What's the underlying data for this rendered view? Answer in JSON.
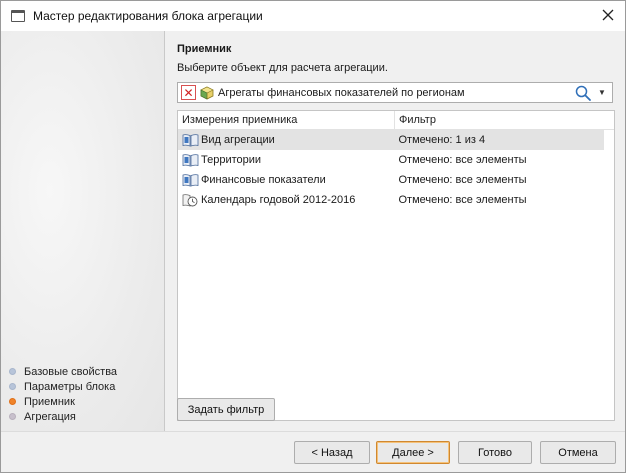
{
  "window": {
    "title": "Мастер редактирования блока агрегации"
  },
  "sidebar": {
    "steps": [
      {
        "label": "Базовые свойства",
        "state": "done"
      },
      {
        "label": "Параметры блока",
        "state": "done"
      },
      {
        "label": "Приемник",
        "state": "active"
      },
      {
        "label": "Агрегация",
        "state": "pending"
      }
    ],
    "colors": {
      "done": "#b7c4d9",
      "active": "#f0842a",
      "pending": "#c8c0cc"
    }
  },
  "section": {
    "title": "Приемник",
    "subtitle": "Выберите объект для расчета агрегации."
  },
  "object_select": {
    "value": "Агрегаты финансовых показателей по регионам",
    "clear_icon": "clear-x-icon",
    "object_icon": "cube-icon",
    "search_icon": "search-icon",
    "dropdown_icon": "chevron-down-icon"
  },
  "grid": {
    "columns": [
      "Измерения приемника",
      "Фильтр"
    ],
    "rows": [
      {
        "name": "Вид агрегации",
        "filter": "Отмечено: 1 из 4",
        "icon": "dictionary-icon",
        "selected": true
      },
      {
        "name": "Территории",
        "filter": "Отмечено: все элементы",
        "icon": "dictionary-icon",
        "selected": false
      },
      {
        "name": "Финансовые показатели",
        "filter": "Отмечено: все элементы",
        "icon": "dictionary-icon",
        "selected": false
      },
      {
        "name": "Календарь годовой 2012-2016",
        "filter": "Отмечено: все элементы",
        "icon": "calendar-dictionary-icon",
        "selected": false
      }
    ]
  },
  "buttons": {
    "set_filter": "Задать фильтр",
    "back": "< Назад",
    "next": "Далее >",
    "done": "Готово",
    "cancel": "Отмена"
  }
}
